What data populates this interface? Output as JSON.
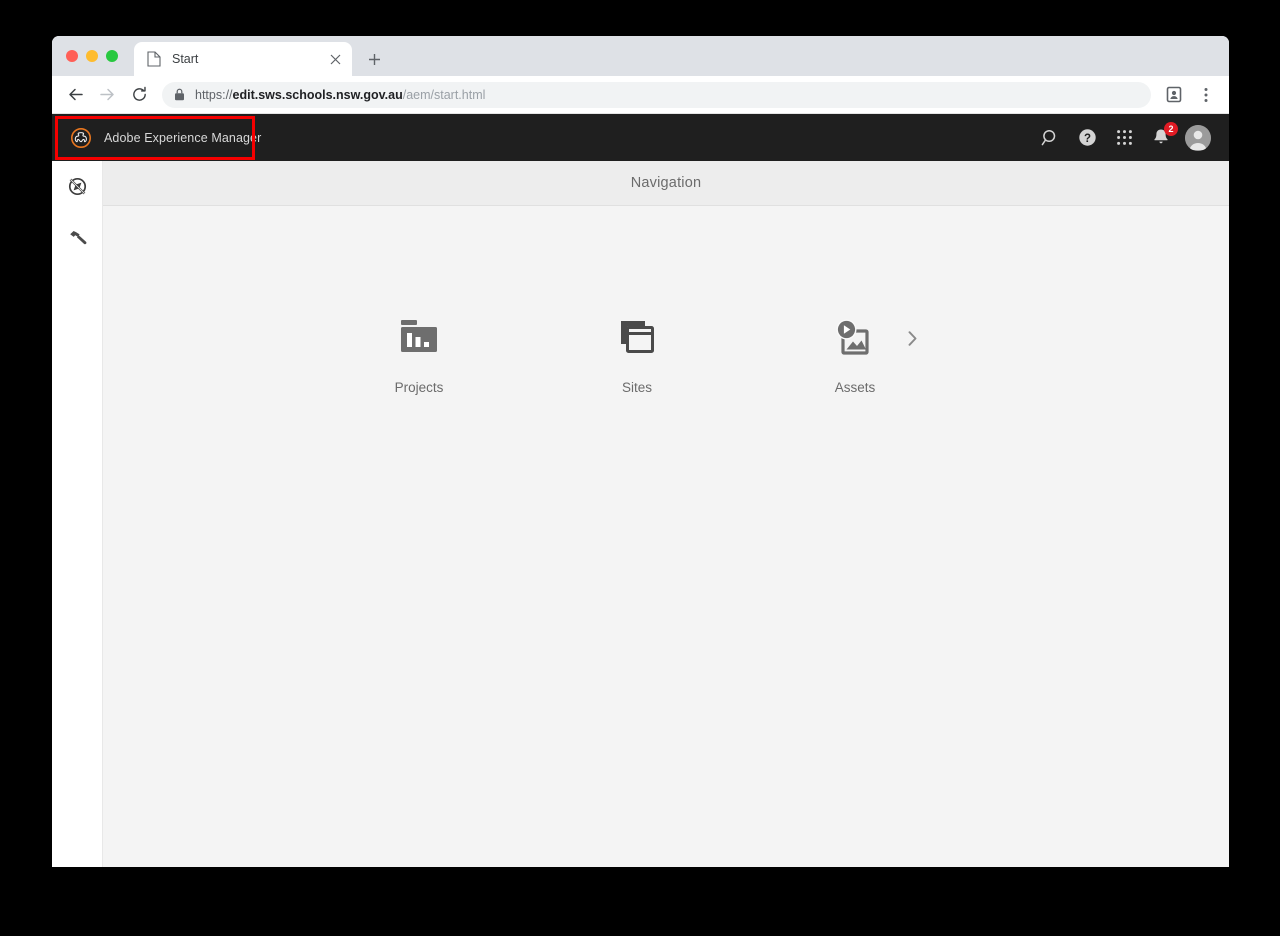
{
  "browser": {
    "window_controls": [
      "close",
      "minimize",
      "maximize"
    ],
    "tab": {
      "title": "Start",
      "favicon": "page-icon",
      "close_label": "×"
    },
    "new_tab_label": "+",
    "toolbar": {
      "back_label": "←",
      "forward_label": "→",
      "reload_label": "⟳",
      "lock_icon": "lock-icon",
      "url_scheme": "https://",
      "url_domain": "edit.sws.schools.nsw.gov.au",
      "url_path": "/aem/start.html",
      "profile_icon": "profile-card-icon",
      "menu_icon": "kebab-menu-icon"
    }
  },
  "aem": {
    "header": {
      "logo_icon": "adobe-experience-manager-logo",
      "brand_title": "Adobe Experience Manager",
      "actions": [
        {
          "name": "search-icon",
          "label": "Search"
        },
        {
          "name": "help-icon",
          "label": "Help"
        },
        {
          "name": "solutions-grid-icon",
          "label": "Solutions"
        },
        {
          "name": "notifications-bell-icon",
          "label": "Inbox",
          "badge": "2"
        },
        {
          "name": "avatar",
          "label": "User"
        }
      ]
    },
    "rail": {
      "items": [
        {
          "name": "navigation-toggle-icon",
          "label": "Navigation"
        },
        {
          "name": "tools-hammer-icon",
          "label": "Tools"
        }
      ]
    },
    "content": {
      "title": "Navigation",
      "tiles": [
        {
          "name": "projects",
          "label": "Projects",
          "icon": "projects-folder-chart-icon",
          "has_chevron": false
        },
        {
          "name": "sites",
          "label": "Sites",
          "icon": "sites-windows-icon",
          "has_chevron": false
        },
        {
          "name": "assets",
          "label": "Assets",
          "icon": "assets-media-icon",
          "has_chevron": true,
          "chevron": "›"
        }
      ]
    }
  },
  "annotation": {
    "target": "brand-title-highlight",
    "color": "#f50000"
  }
}
